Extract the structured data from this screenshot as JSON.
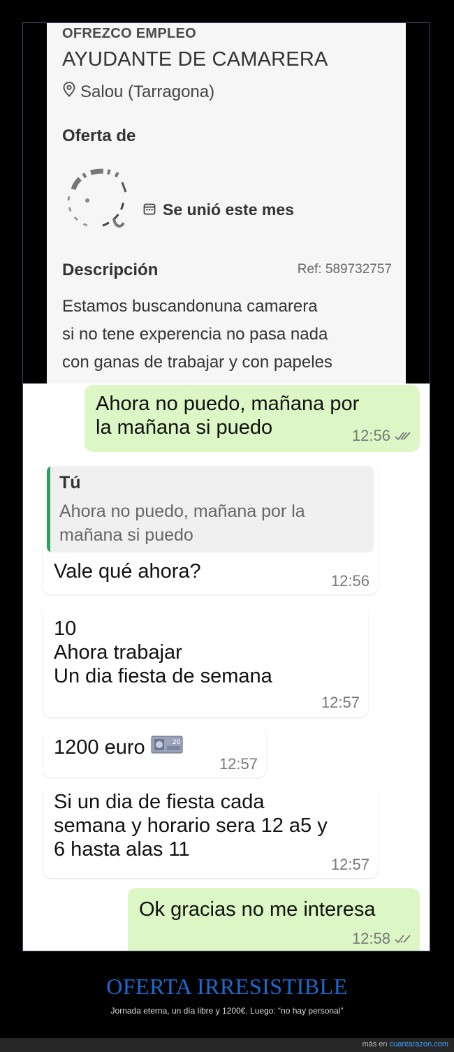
{
  "job": {
    "category": "OFREZCO EMPLEO",
    "title": "AYUDANTE DE CAMARERA",
    "location": "Salou (Tarragona)",
    "offer_label": "Oferta de",
    "joined": "Se unió este mes",
    "description_label": "Descripción",
    "ref": "Ref: 589732757",
    "description_lines": [
      "Estamos buscandonuna camarera",
      "si no tene experencia no pasa nada",
      "con ganas de trabajar y con papeles"
    ]
  },
  "chat": {
    "m1": {
      "lines": [
        "Ahora no puedo, mañana por",
        "la mañana si puedo"
      ],
      "time": "12:56"
    },
    "m2": {
      "quote_author": "Tú",
      "quote_lines": [
        "Ahora no puedo, mañana por la",
        "mañana si puedo"
      ],
      "text": "Vale qué ahora?",
      "time": "12:56"
    },
    "m3": {
      "lines": [
        "10",
        "Ahora trabajar",
        "Un dia fiesta de semana"
      ],
      "time": "12:57"
    },
    "m4": {
      "text": "1200 euro",
      "time": "12:57"
    },
    "m5": {
      "lines": [
        "Si un dia de fiesta cada",
        "semana y horario sera 12 a5 y",
        "6 hasta alas 11"
      ],
      "time": "12:57"
    },
    "m6": {
      "text": "Ok gracias no me interesa",
      "time": "12:58"
    }
  },
  "footer": {
    "headline": "OFERTA IRRESISTIBLE",
    "subline": "Jornada eterna, un día libre y 1200€. Luego: “no hay personal”",
    "more_prefix": "más en",
    "more_link": "cuantarazon.com"
  },
  "colors": {
    "outgoing": "#dcf7c5",
    "quote_bar": "#25a35a",
    "headline": "#1d6bd0",
    "link": "#3da0ff"
  },
  "icons": [
    "location-pin-icon",
    "calendar-icon",
    "double-check-icon",
    "euro-banknote-icon"
  ]
}
